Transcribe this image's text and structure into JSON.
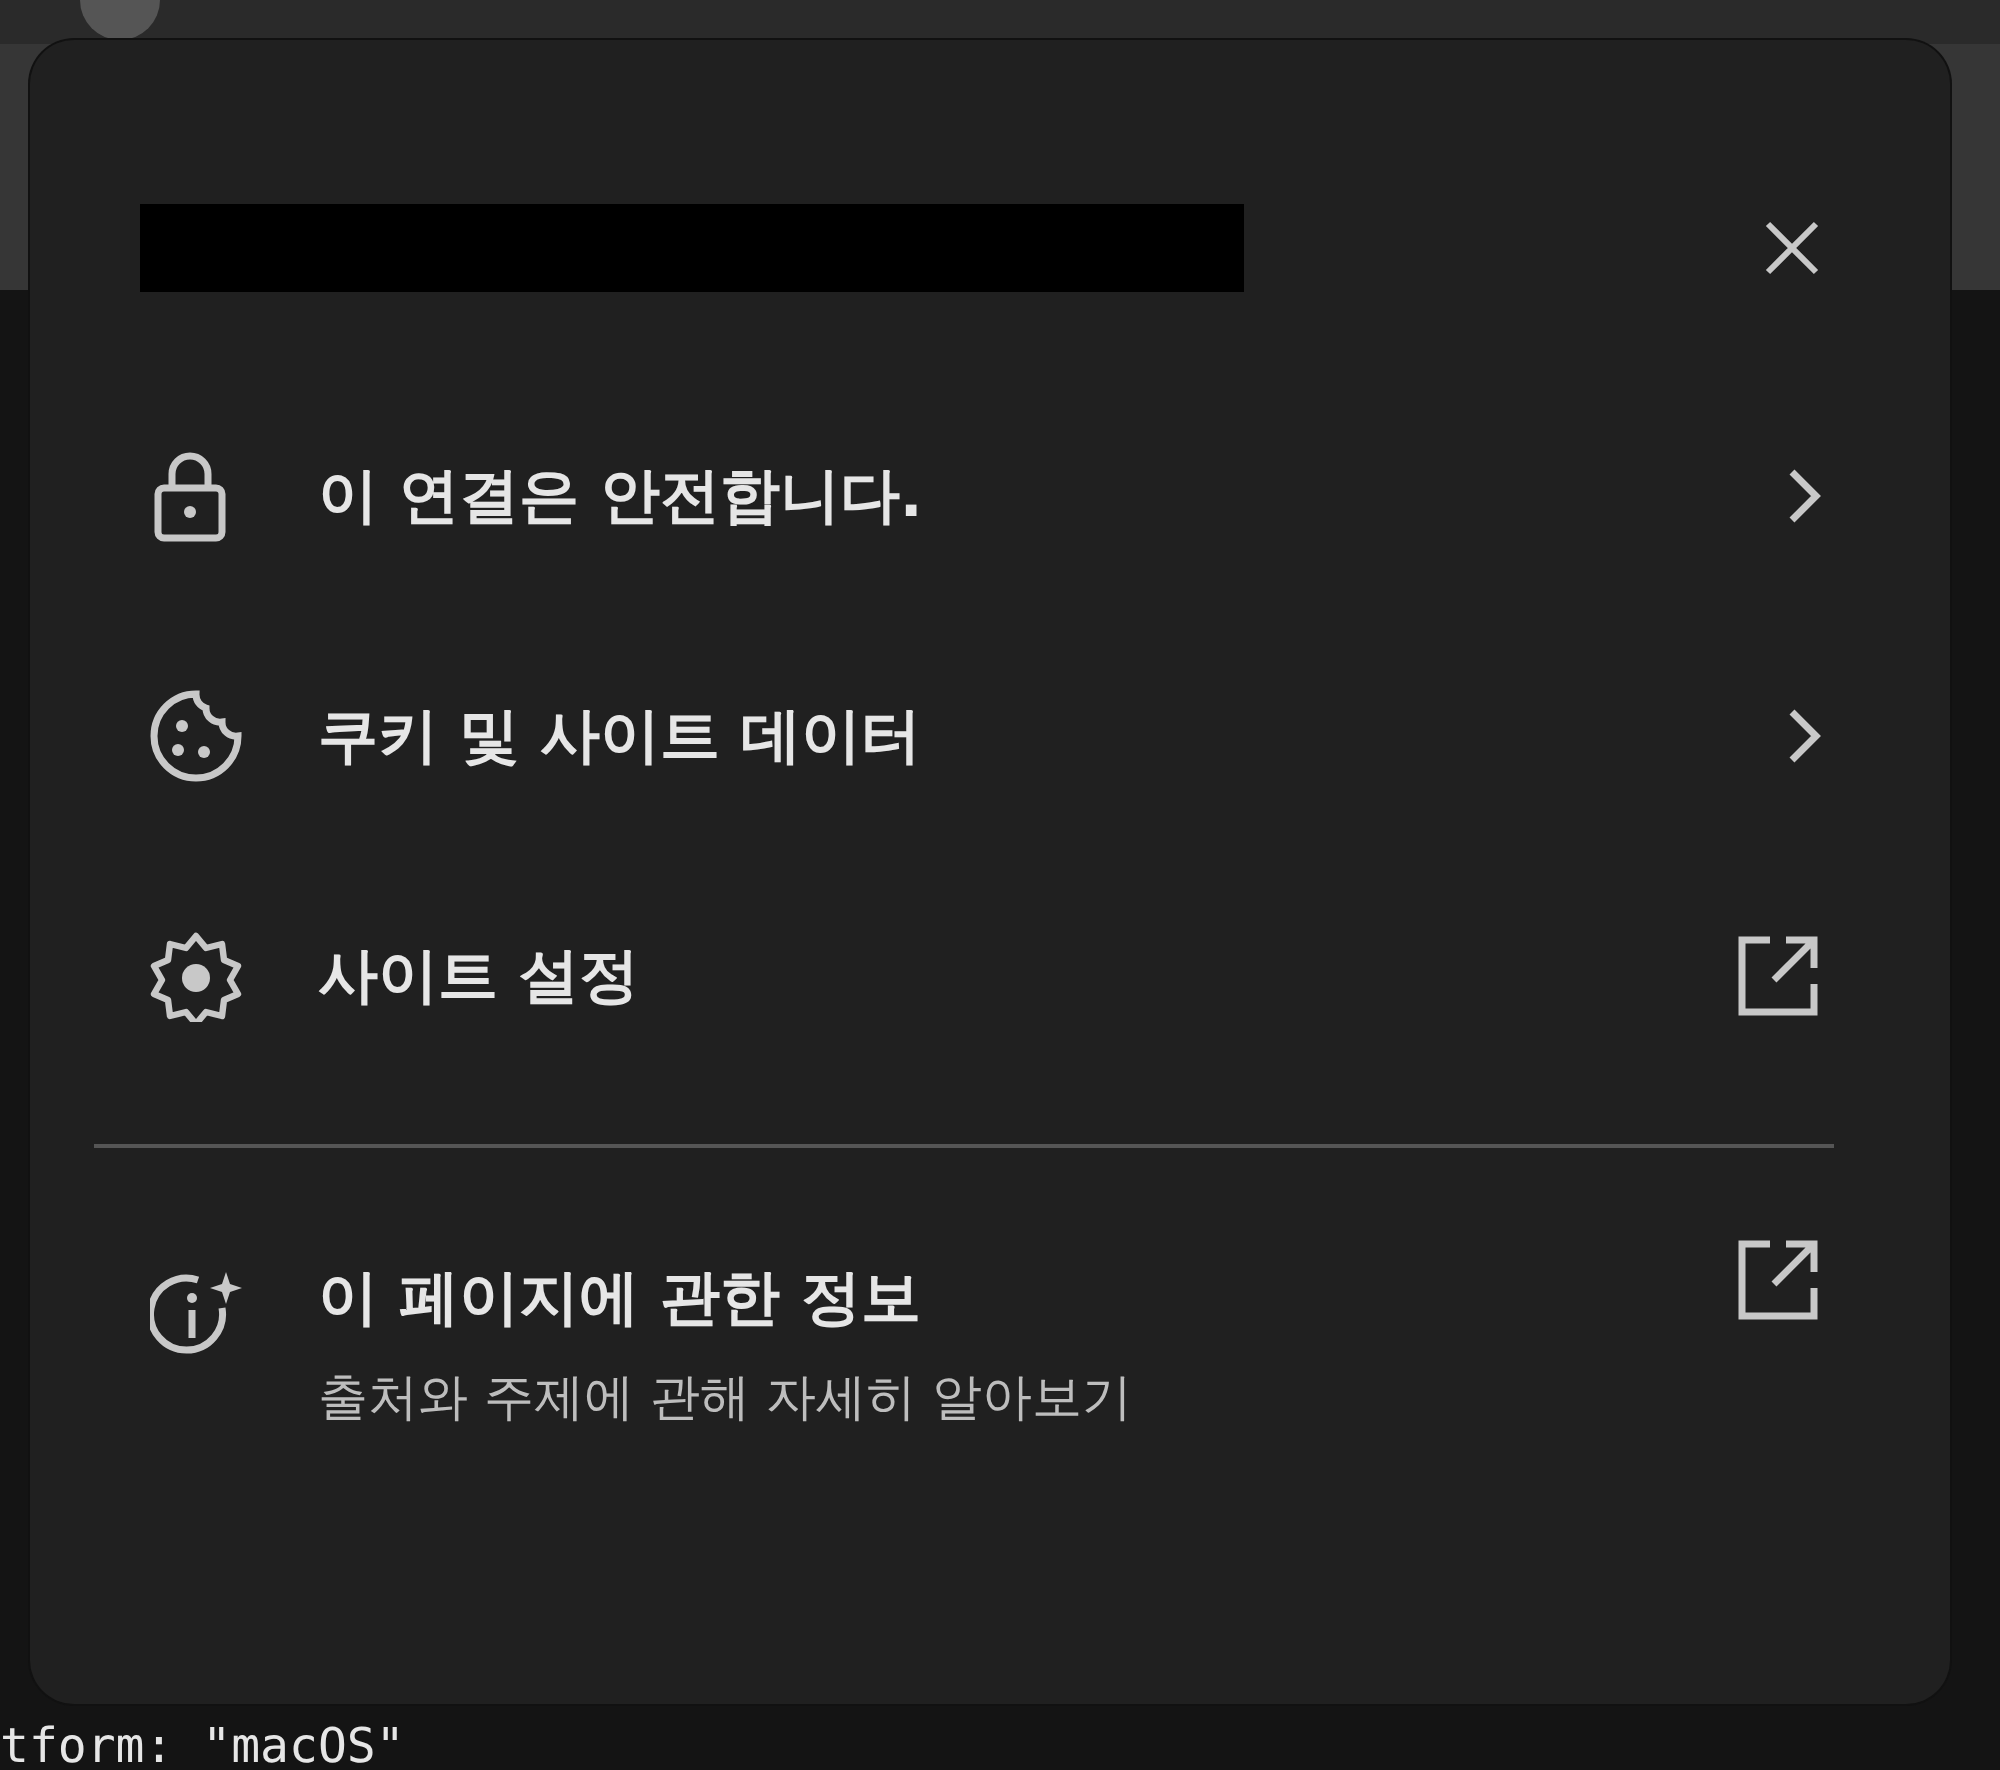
{
  "background": {
    "code_last_line": "tform: \"macOS\""
  },
  "popup": {
    "title_redacted": true,
    "items": [
      {
        "kind": "lock",
        "label": "이 연결은 안전합니다.",
        "opens_external": false
      },
      {
        "kind": "cookie",
        "label": "쿠키 및 사이트 데이터",
        "opens_external": false
      },
      {
        "kind": "gear",
        "label": "사이트 설정",
        "opens_external": true
      }
    ],
    "info": {
      "kind": "info",
      "label": "이 페이지에 관한 정보",
      "subtitle": "출처와 주제에 관해 자세히 알아보기",
      "opens_external": true
    }
  }
}
